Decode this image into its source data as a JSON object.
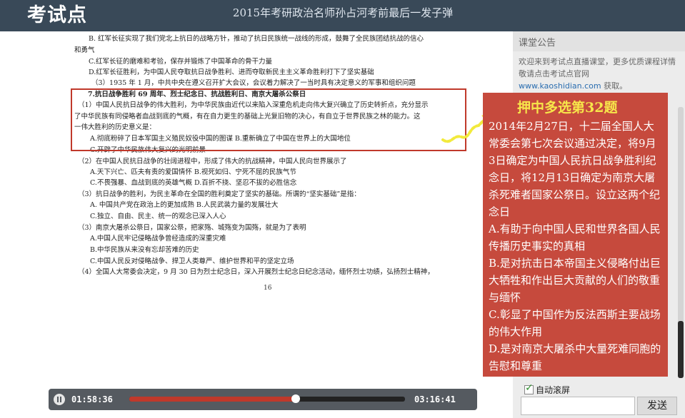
{
  "header": {
    "logo_text": "考试点",
    "title": "2015年考研政治名师孙占河考前最后一发子弹"
  },
  "document": {
    "lines": [
      {
        "text": "B. 红军长征实现了我们党北上抗日的战略方针，推动了抗日民族统一战线的形成，鼓舞了全民族团结抗战的信心",
        "bold": false
      },
      {
        "text": "和勇气",
        "bold": false
      },
      {
        "text": "C.红军长征的磨难和考验，保存并锻炼了中国革命的骨干力量",
        "bold": false
      },
      {
        "text": "D.红军长征胜利，为中国人民夺取抗日战争胜利、进而夺取新民主主义革命胜利打下了坚实基础",
        "bold": false
      },
      {
        "text": "（3）1935 年 1 月，中共中央在遵义召开扩大会议，会议着力解决了一当时具有决定意义的军事和组织问题",
        "bold": false
      },
      {
        "text": "7.抗日战争胜利 69 周年、烈士纪念日、抗战胜利日、南京大屠杀公祭日",
        "bold": true
      },
      {
        "text": "（1）中国人民抗日战争的伟大胜利，为中华民族由近代以来陷入深重危机走向伟大复兴确立了历史转折点，充分显示",
        "bold": false
      },
      {
        "text": "了中华民族有同侵略者血战到底的气概，有在自力更生的基础上光复旧物的决心，有自立于世界民族之林的能力。这",
        "bold": false
      },
      {
        "text": "一伟大胜利的历史意义是：",
        "bold": false
      },
      {
        "text": "A.彻底粉碎了日本军国主义殖民奴役中国的图谋    B.重新确立了中国在世界上的大国地位",
        "bold": false
      },
      {
        "text": "C.开辟了中华民族伟大复兴的光明前景",
        "bold": false
      },
      {
        "text": "（2）在中国人民抗日战争的壮阔进程中，形成了伟大的抗战精神，中国人民向世界展示了",
        "bold": false
      },
      {
        "text": "A.天下兴亡、匹夫有责的爱国情怀    B.视死如归、宁死不屈的民族气节",
        "bold": false
      },
      {
        "text": "C.不畏强暴、血战到底的英雄气概    D.百折不挠、坚忍不拔的必胜信念",
        "bold": false
      },
      {
        "text": "（3）抗日战争的胜利，为民主革命在全国的胜利奠定了坚实的基础。所谓的“坚实基础”是指：",
        "bold": false
      },
      {
        "text": "A. 中国共产党在政治上的更加成熟        B.人民武装力量的发展壮大",
        "bold": false
      },
      {
        "text": "C.独立、自由、民主、统一的观念已深入人心",
        "bold": false
      },
      {
        "text": "（3）南京大屠杀公祭日，国家公祭，把家殇、城殇变为国殇，就是为了表明",
        "bold": false
      },
      {
        "text": "A.中国人民牢记侵略战争曾经造成的深重灾难",
        "bold": false
      },
      {
        "text": "B.中华民族从来没有忘却苦难的历史",
        "bold": false
      },
      {
        "text": "C.中国人民反对侵略战争、捍卫人类尊严、维护世界和平的坚定立场",
        "bold": false
      },
      {
        "text": "（4）全国人大常委会决定，9 月 30 日为烈士纪念日，深入开展烈士纪念日纪念活动，缅怀烈士功绩，弘扬烈士精神，",
        "bold": false
      }
    ],
    "page_number": "16"
  },
  "player": {
    "current_time": "01:58:36",
    "total_time": "03:16:41",
    "progress": 0.6027
  },
  "sidebar": {
    "notice_title": "课堂公告",
    "notice_text": "欢迎来到考试点直播课堂，更多优质课程详情敬请点击考试点官网",
    "notice_link": "www.kaoshidian.com",
    "notice_suffix": " 获取。",
    "autoscroll_label": "自动滚屏",
    "autoscroll_checked": true,
    "chat_input_value": "",
    "send_label": "发送"
  },
  "callout": {
    "title": "押中多选第32题",
    "body": [
      "2014年2月27日，十二届全国人大常委会第七次会议通过决定，将9月3日确定为中国人民抗日战争胜利纪念日，将12月13日确定为南京大屠杀死难者国家公祭日。设立这两个纪念日",
      "A.有助于向中国人民和世界各国人民传播历史事实的真相",
      "B.是对抗击日本帝国主义侵略付出巨大牺牲和作出巨大贡献的人们的敬重与缅怀",
      "C.彰显了中国作为反法西斯主要战场的伟大作用",
      "D.是对南京大屠杀中大量死难同胞的告慰和尊重"
    ]
  },
  "colors": {
    "header_bg": "#394958",
    "callout_bg": "#c64a3d",
    "callout_title": "#f7e64a",
    "highlight_border": "#c0392b",
    "progress_fill": "#c0392b",
    "arrow": "#f2ea3c"
  }
}
